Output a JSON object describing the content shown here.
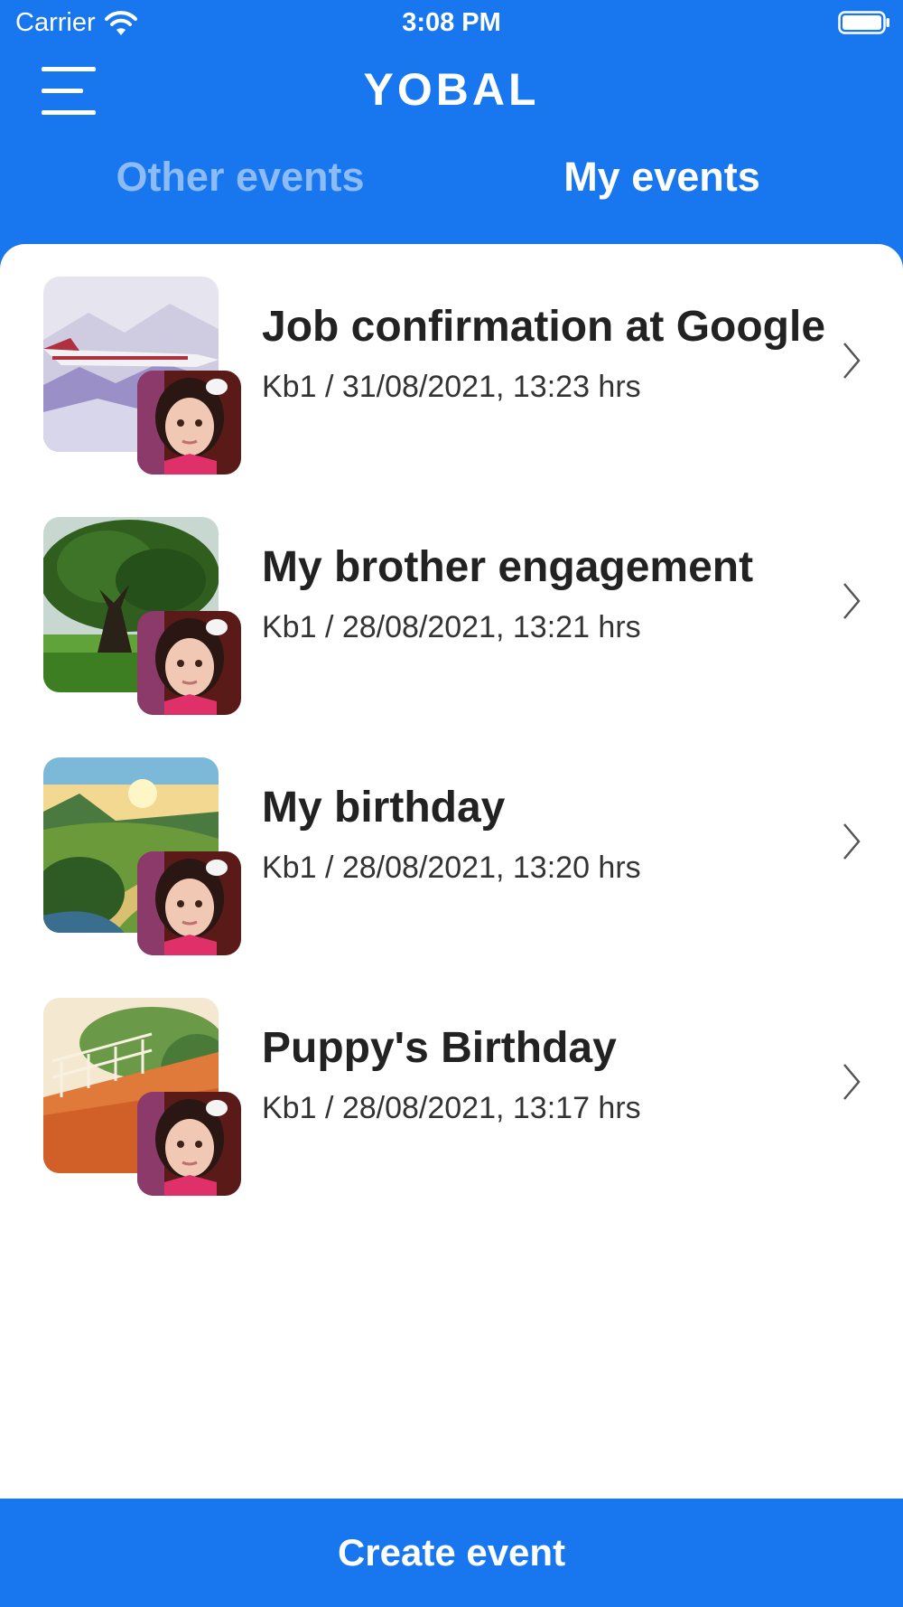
{
  "status_bar": {
    "carrier": "Carrier",
    "time": "3:08 PM",
    "icons": [
      "wifi-icon",
      "battery-icon"
    ]
  },
  "header": {
    "brand": "YOBAL",
    "menu_icon": "hamburger-menu-icon"
  },
  "tabs": [
    {
      "label": "Other events",
      "selected": false
    },
    {
      "label": "My events",
      "selected": true
    }
  ],
  "events": [
    {
      "title": "Job confirmation at Google",
      "subtitle": "Kb1 / 31/08/2021, 13:23 hrs",
      "image": "jet-over-mountains",
      "avatar": "girl-portrait"
    },
    {
      "title": "My brother engagement",
      "subtitle": "Kb1 / 28/08/2021, 13:21 hrs",
      "image": "tree-in-meadow",
      "avatar": "girl-portrait"
    },
    {
      "title": "My birthday",
      "subtitle": "Kb1 / 28/08/2021, 13:20 hrs",
      "image": "sunset-valley",
      "avatar": "girl-portrait"
    },
    {
      "title": "Puppy's Birthday",
      "subtitle": "Kb1 / 28/08/2021, 13:17 hrs",
      "image": "wooden-boardwalk",
      "avatar": "girl-portrait"
    }
  ],
  "footer": {
    "create_label": "Create event"
  },
  "colors": {
    "primary": "#1877EE",
    "tab_inactive": "#8DBBF6",
    "text_dark": "#222222"
  }
}
